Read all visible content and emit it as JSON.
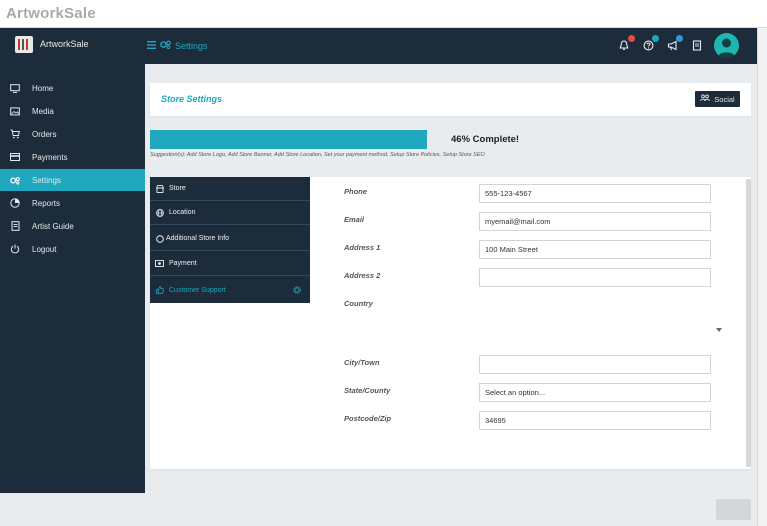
{
  "window": {
    "title": "ArtworkSale"
  },
  "topbar": {
    "app_name": "ArtworkSale",
    "breadcrumb": "Settings",
    "icons": [
      {
        "name": "bell-icon",
        "badge_color": "#e74c3c"
      },
      {
        "name": "help-icon",
        "badge_color": "#1fa8bd"
      },
      {
        "name": "megaphone-icon",
        "badge_color": "#3498db"
      },
      {
        "name": "document-icon"
      }
    ]
  },
  "sidebar": {
    "items": [
      {
        "label": "Home",
        "icon": "monitor-icon"
      },
      {
        "label": "Media",
        "icon": "image-icon"
      },
      {
        "label": "Orders",
        "icon": "cart-icon"
      },
      {
        "label": "Payments",
        "icon": "card-icon"
      },
      {
        "label": "Settings",
        "icon": "gears-icon",
        "active": true
      },
      {
        "label": "Reports",
        "icon": "pie-chart-icon"
      },
      {
        "label": "Artist Guide",
        "icon": "book-icon"
      },
      {
        "label": "Logout",
        "icon": "power-icon"
      }
    ]
  },
  "settings": {
    "title": "Store Settings",
    "social_label": "Social",
    "progress_percent": 46,
    "progress_text": "46% Complete!",
    "suggestions": "Suggestion(s): Add Store Logo, Add Store Banner, Add Store Location, Set your payment method, Setup Store Policies, Setup Store SEO",
    "tabs": [
      {
        "label": "Store",
        "icon": "store-icon"
      },
      {
        "label": "Location",
        "icon": "globe-icon"
      },
      {
        "label": "Additional Store Info",
        "icon": "circle-icon"
      },
      {
        "label": "Payment",
        "icon": "money-icon"
      },
      {
        "label": "Customer Support",
        "icon": "thumbs-up-icon",
        "active": true
      }
    ],
    "fields": {
      "phone": {
        "label": "Phone",
        "value": "555-123-4567"
      },
      "email": {
        "label": "Email",
        "value": "myemail@mail.com"
      },
      "address1": {
        "label": "Address 1",
        "value": "100 Main Street"
      },
      "address2": {
        "label": "Address 2",
        "value": ""
      },
      "country": {
        "label": "Country",
        "value": ""
      },
      "city": {
        "label": "City/Town",
        "value": ""
      },
      "state": {
        "label": "State/County",
        "value": "Select an option..."
      },
      "postcode": {
        "label": "Postcode/Zip",
        "value": "34695"
      }
    }
  },
  "colors": {
    "accent": "#1fa8bd",
    "navy": "#1d2c3a",
    "background": "#e9ecef"
  }
}
